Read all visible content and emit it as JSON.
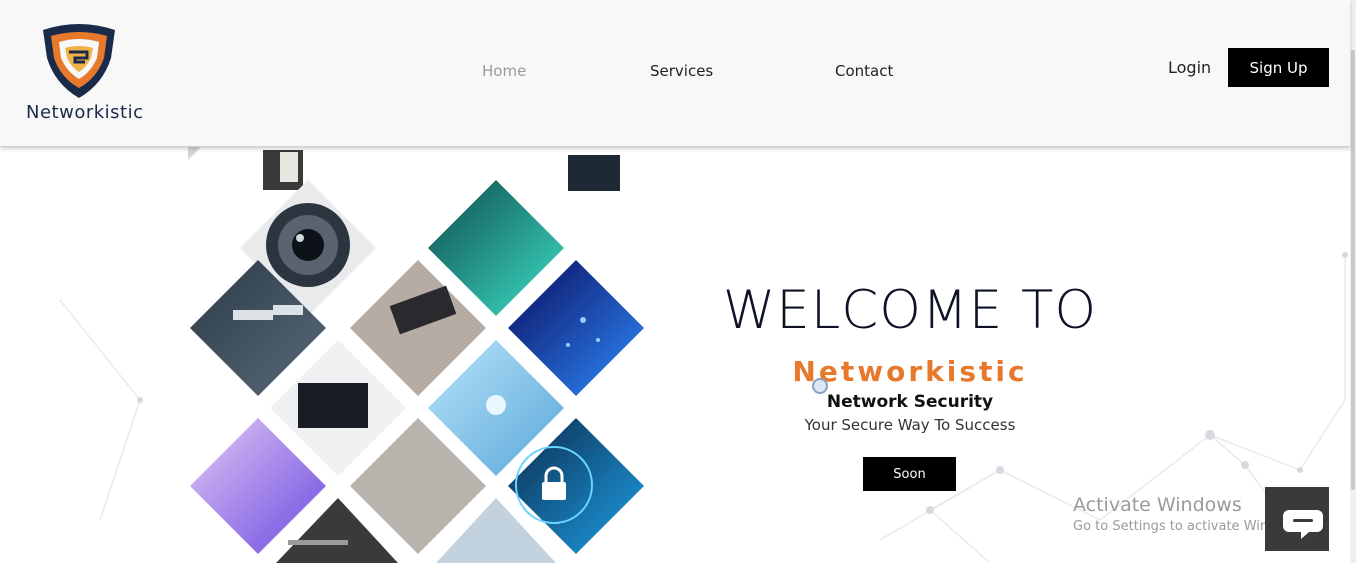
{
  "colors": {
    "accent_orange": "#e7792c",
    "navy": "#1a2b4a",
    "black": "#000000",
    "header_bg": "#f8f8f8"
  },
  "header": {
    "logo_text": "Networkistic",
    "nav": [
      {
        "label": "Home",
        "active": true
      },
      {
        "label": "Services"
      },
      {
        "label": "Contact"
      }
    ],
    "login_label": "Login",
    "signup_label": "Sign Up"
  },
  "mosaic": {
    "icons": [
      "door-lock-icon",
      "security-camera-icon",
      "fingerprint-icon",
      "circuit-icon",
      "monitoring-icon",
      "fiber-optic-icon",
      "laptop-icon",
      "network-nodes-icon",
      "code-laptop-icon",
      "server-rack-icon",
      "padlock-icon"
    ]
  },
  "hero": {
    "welcome": "WELCOME TO",
    "brand": "Networkistic",
    "tagline": "Network Security",
    "subtitle": "Your Secure Way To Success",
    "button_label": "Soon"
  },
  "watermark": {
    "title": "Activate Windows",
    "subtitle": "Go to Settings to activate Windows."
  },
  "chat": {
    "icon": "chat-bubble-icon"
  }
}
